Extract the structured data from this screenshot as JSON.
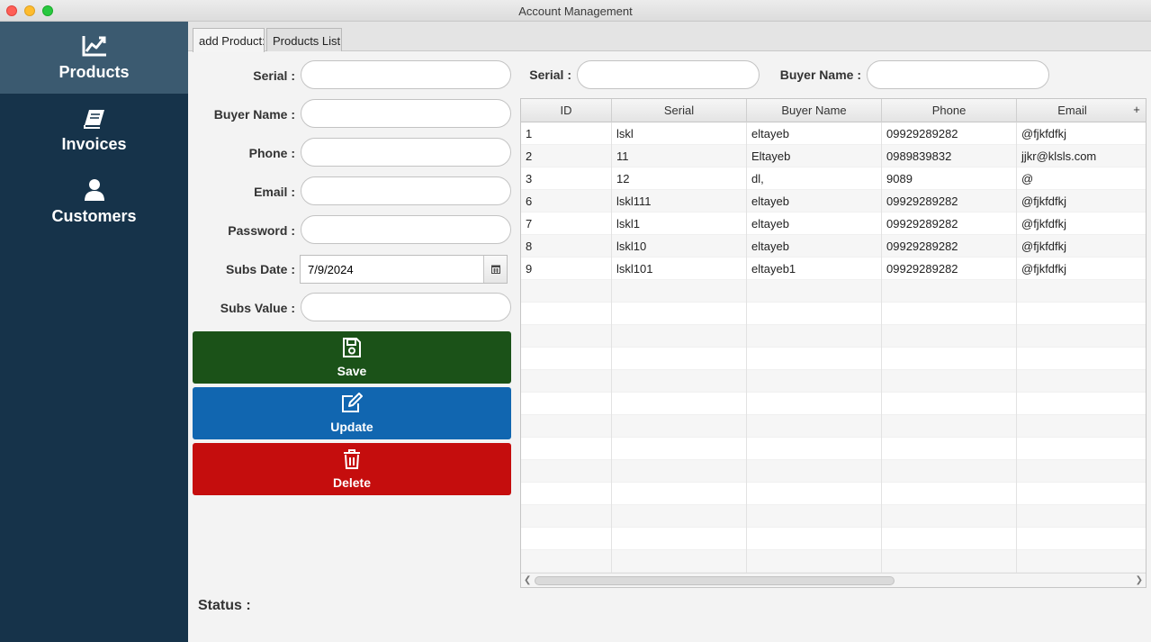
{
  "window": {
    "title": "Account Management"
  },
  "sidebar": {
    "items": [
      {
        "label": "Products",
        "icon": "chart-line-icon",
        "active": true
      },
      {
        "label": "Invoices",
        "icon": "book-icon",
        "active": false
      },
      {
        "label": "Customers",
        "icon": "user-icon",
        "active": false
      }
    ]
  },
  "tabs": [
    {
      "label": "add Product:",
      "active": true
    },
    {
      "label": "Products List",
      "active": false
    }
  ],
  "form": {
    "serial_label": "Serial :",
    "buyer_name_label": "Buyer Name :",
    "phone_label": "Phone :",
    "email_label": "Email :",
    "password_label": "Password :",
    "subs_date_label": "Subs Date :",
    "subs_date_value": "7/9/2024",
    "subs_value_label": "Subs Value :"
  },
  "actions": {
    "save": {
      "label": "Save",
      "color": "#1b5218"
    },
    "update": {
      "label": "Update",
      "color": "#1166b0"
    },
    "delete": {
      "label": "Delete",
      "color": "#c50d0d"
    }
  },
  "status": {
    "label": "Status :"
  },
  "filters": {
    "serial_label": "Serial :",
    "buyer_name_label": "Buyer Name :"
  },
  "table": {
    "columns": [
      "ID",
      "Serial",
      "Buyer Name",
      "Phone",
      "Email"
    ],
    "column_menu_glyph": "+",
    "rows": [
      [
        "1",
        "lskl",
        "eltayeb",
        "09929289282",
        "@fjkfdfkj"
      ],
      [
        "2",
        "11",
        "Eltayeb",
        "0989839832",
        "jjkr@klsls.com"
      ],
      [
        "3",
        "12",
        "dl,",
        "9089",
        "@"
      ],
      [
        "6",
        "lskl111",
        "eltayeb",
        "09929289282",
        "@fjkfdfkj"
      ],
      [
        "7",
        "lskl1",
        "eltayeb",
        "09929289282",
        "@fjkfdfkj"
      ],
      [
        "8",
        "lskl10",
        "eltayeb",
        "09929289282",
        "@fjkfdfkj"
      ],
      [
        "9",
        "lskl101",
        "eltayeb1",
        "09929289282",
        "@fjkfdfkj"
      ]
    ]
  },
  "colors": {
    "sidebar_bg": "#16334a",
    "sidebar_active_bg": "#3b5a70"
  }
}
